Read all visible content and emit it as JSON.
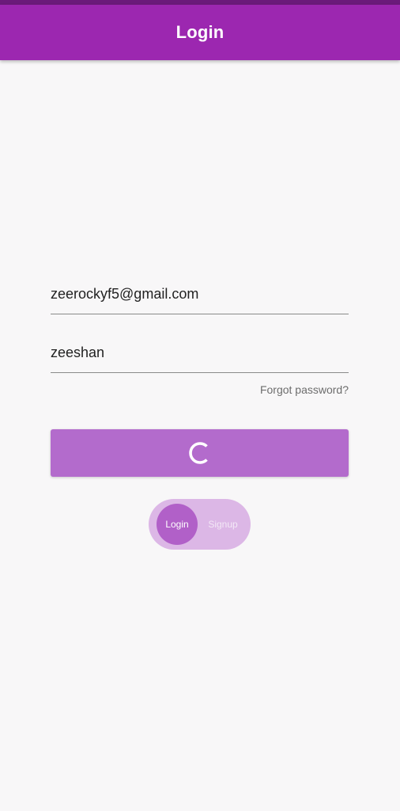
{
  "app_bar": {
    "title": "Login"
  },
  "form": {
    "email_value": "zeerockyf5@gmail.com",
    "password_value": "zeeshan",
    "forgot_password_label": "Forgot password?"
  },
  "toggle": {
    "login_label": "Login",
    "signup_label": "Signup",
    "selected": "Login"
  },
  "icons": {
    "loading": "loading-spinner-icon"
  },
  "colors": {
    "app_bar": "#9c27b0",
    "status_bar": "#6b1a7a",
    "button": "#b36bcc",
    "toggle_track": "#dcb7e6",
    "toggle_thumb": "#b160c8",
    "background": "#f8f7f8"
  }
}
